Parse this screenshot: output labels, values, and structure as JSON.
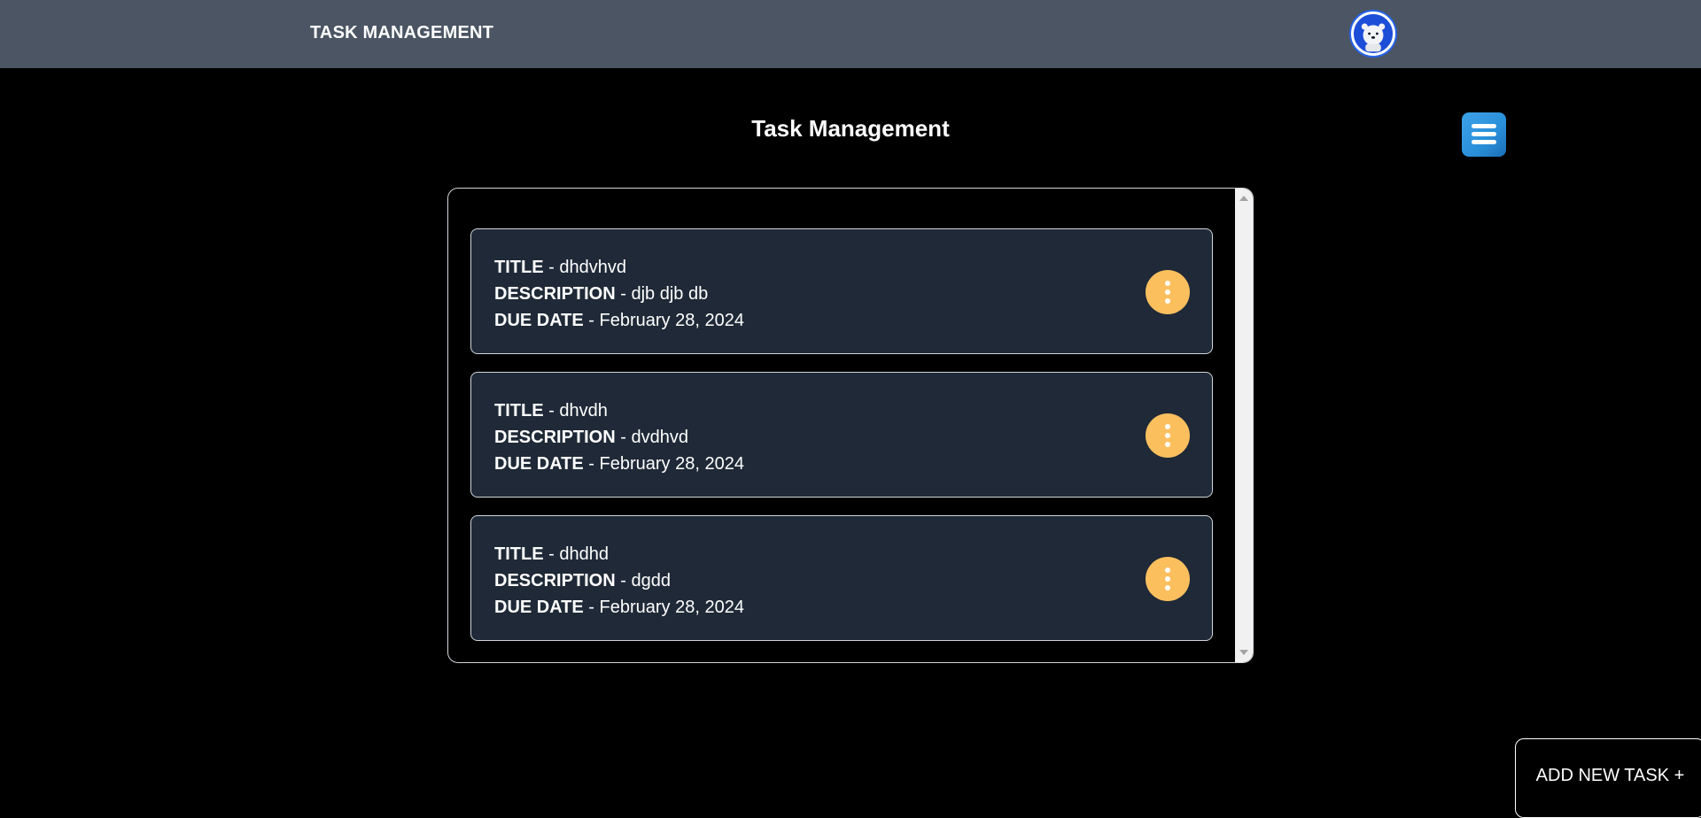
{
  "header": {
    "brand": "TASK MANAGEMENT",
    "avatar_icon": "polar-bear-avatar-icon"
  },
  "main": {
    "title": "Task Management",
    "menu_icon": "hamburger-menu-icon"
  },
  "labels": {
    "title": "TITLE",
    "description": "DESCRIPTION",
    "due_date": "DUE DATE",
    "separator": " - "
  },
  "tasks": [
    {
      "title": "dhdvhvd",
      "description": "djb djb db",
      "due_date": "February 28, 2024"
    },
    {
      "title": "dhvdh",
      "description": "dvdhvd",
      "due_date": "February 28, 2024"
    },
    {
      "title": "dhdhd",
      "description": "dgdd",
      "due_date": "February 28, 2024"
    }
  ],
  "actions": {
    "add_task_label": "ADD NEW TASK +"
  },
  "colors": {
    "header_bg": "#4b5563",
    "card_bg": "#1f2937",
    "kebab_bg": "#fbbf5e",
    "menu_btn": "#2a8fd9"
  }
}
